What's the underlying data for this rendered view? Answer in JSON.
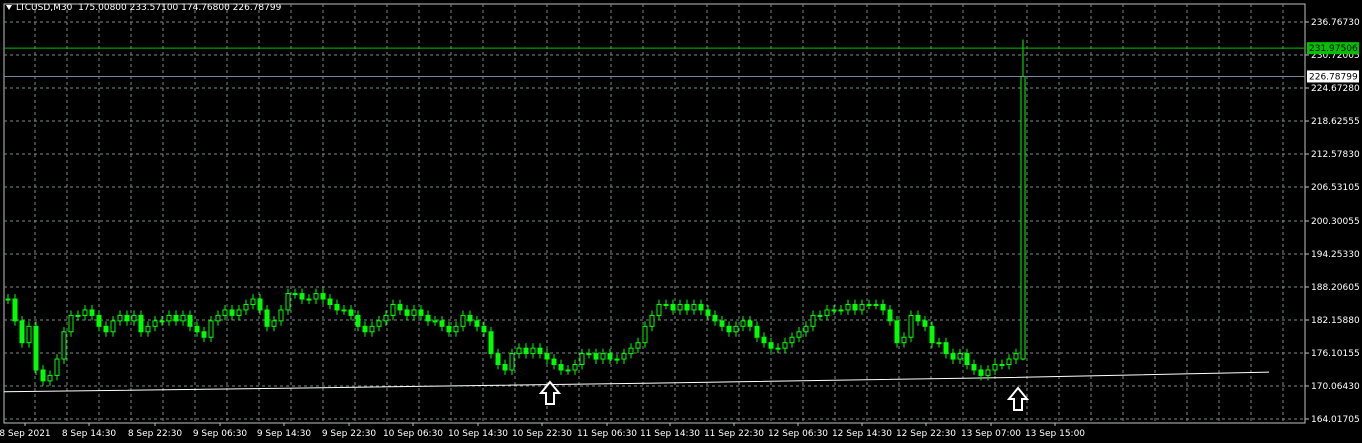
{
  "header": {
    "symbol": "LTCUSD,M30",
    "ohlc": "175.00800 233.57100 174.76800 226.78799"
  },
  "price_labels": {
    "green_line": "231.97506",
    "current": "226.78799"
  },
  "colors": {
    "background": "#000000",
    "grid": "#7a8a8a",
    "bull": "#00ff00",
    "bear": "#00ff00",
    "green_line": "#00c000",
    "current_line": "#778899",
    "white_line": "#ffffff"
  },
  "chart_data": {
    "type": "candlestick",
    "title": "LTCUSD,M30",
    "y_ticks": [
      "236.76730",
      "230.72005",
      "224.67280",
      "218.62555",
      "212.57830",
      "206.53105",
      "200.30055",
      "194.25330",
      "188.20605",
      "182.15880",
      "176.10155",
      "170.06430",
      "164.01705"
    ],
    "x_ticks": [
      "8 Sep 2021",
      "8 Sep 14:30",
      "8 Sep 22:30",
      "9 Sep 06:30",
      "9 Sep 14:30",
      "9 Sep 22:30",
      "10 Sep 06:30",
      "10 Sep 14:30",
      "10 Sep 22:30",
      "11 Sep 06:30",
      "11 Sep 14:30",
      "11 Sep 22:30",
      "12 Sep 06:30",
      "12 Sep 14:30",
      "12 Sep 22:30",
      "13 Sep 07:00",
      "13 Sep 15:00"
    ],
    "ylim": [
      164.01705,
      236.7673
    ],
    "close_path": [
      186,
      182,
      178,
      181,
      173,
      171,
      172,
      175,
      180,
      183,
      183,
      184,
      183,
      181,
      180,
      182,
      183,
      182,
      183,
      180,
      181,
      182,
      182,
      183,
      182,
      183,
      181,
      180,
      179,
      182,
      183,
      184,
      183,
      184,
      185,
      186,
      184,
      181,
      182,
      184,
      187,
      187,
      186,
      186,
      187,
      186,
      185,
      184,
      184,
      183,
      181,
      180,
      181,
      182,
      183,
      185,
      184,
      183,
      184,
      183,
      182,
      182,
      181,
      180,
      181,
      183,
      182,
      181,
      180,
      176,
      174,
      173,
      176,
      177,
      176,
      177,
      176,
      175,
      174,
      173,
      173,
      174,
      176,
      176,
      175,
      176,
      175,
      175,
      176,
      177,
      178,
      181,
      183,
      185,
      185,
      184,
      185,
      184,
      185,
      184,
      183,
      182,
      181,
      180,
      181,
      182,
      181,
      179,
      178,
      177,
      177,
      178,
      179,
      180,
      181,
      183,
      183,
      184,
      184,
      184,
      185,
      184,
      185,
      185,
      185,
      184,
      182,
      178,
      179,
      183,
      182,
      181,
      178,
      178,
      176,
      175,
      176,
      174,
      173,
      172,
      173,
      174,
      174,
      175,
      176
    ],
    "horizontal_lines": {
      "green": 231.97506,
      "current": 226.78799
    },
    "white_trend": [
      [
        0,
        169.0
      ],
      [
        300,
        169.7
      ],
      [
        650,
        170.6
      ],
      [
        1000,
        171.6
      ],
      [
        1265,
        172.6
      ]
    ],
    "markers": [
      "arrow-up-1",
      "arrow-up-2"
    ],
    "grid": true
  }
}
